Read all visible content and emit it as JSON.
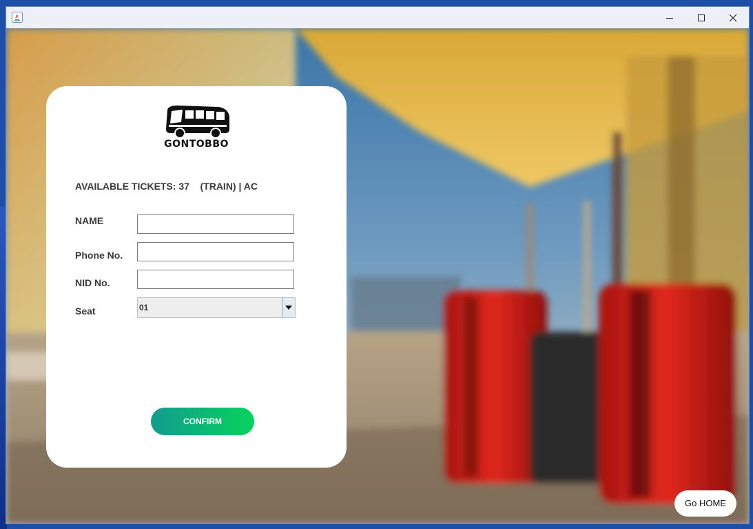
{
  "window": {
    "title": "",
    "controls": {
      "minimize_icon": "minimize-icon",
      "maximize_icon": "maximize-icon",
      "close_icon": "close-icon"
    }
  },
  "logo": {
    "text": "GONTOBBO",
    "icon": "bus-icon"
  },
  "booking": {
    "available_text": "AVAILABLE TICKETS: 37    (TRAIN) | AC",
    "labels": {
      "name": "NAME",
      "phone": "Phone No.",
      "nid": "NID No.",
      "seat": "Seat"
    },
    "values": {
      "name": "",
      "phone": "",
      "nid": ""
    },
    "seat_selected": "01",
    "confirm_label": "CONFIRM"
  },
  "nav": {
    "home_label": "Go HOME"
  },
  "colors": {
    "confirm_start": "#129c8e",
    "confirm_end": "#06d35c",
    "luggage": "#d8261c"
  }
}
